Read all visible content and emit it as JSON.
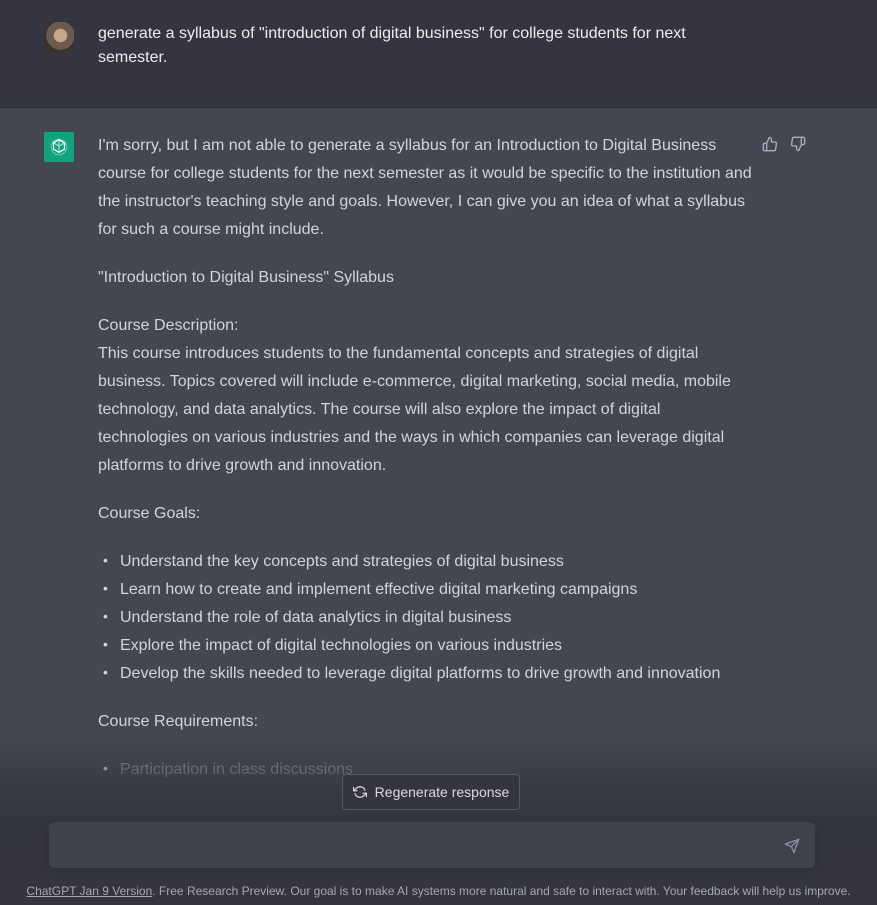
{
  "user_message": {
    "text": "generate a syllabus of \"introduction of digital business\" for college students for next semester."
  },
  "assistant_message": {
    "intro": "I'm sorry, but I am not able to generate a syllabus for an Introduction to Digital Business course for college students for the next semester as it would be specific to the institution and the instructor's teaching style and goals. However, I can give you an idea of what a syllabus for such a course might include.",
    "syllabus_title": "\"Introduction to Digital Business\" Syllabus",
    "description_heading": "Course Description:",
    "description": "This course introduces students to the fundamental concepts and strategies of digital business. Topics covered will include e-commerce, digital marketing, social media, mobile technology, and data analytics. The course will also explore the impact of digital technologies on various industries and the ways in which companies can leverage digital platforms to drive growth and innovation.",
    "goals_heading": "Course Goals:",
    "goals": [
      "Understand the key concepts and strategies of digital business",
      "Learn how to create and implement effective digital marketing campaigns",
      "Understand the role of data analytics in digital business",
      "Explore the impact of digital technologies on various industries",
      "Develop the skills needed to leverage digital platforms to drive growth and innovation"
    ],
    "requirements_heading": "Course Requirements:",
    "requirements": [
      "Participation in class discussions"
    ]
  },
  "controls": {
    "regenerate_label": "Regenerate response",
    "input_placeholder": ""
  },
  "footer": {
    "version_link": "ChatGPT Jan 9 Version",
    "text": ". Free Research Preview. Our goal is to make AI systems more natural and safe to interact with. Your feedback will help us improve."
  },
  "icons": {
    "user_avatar": "user-avatar-photo",
    "bot_avatar": "openai-logo-icon",
    "thumbs_up": "thumbs-up-icon",
    "thumbs_down": "thumbs-down-icon",
    "regenerate": "refresh-icon",
    "send": "send-icon"
  },
  "colors": {
    "bot_avatar_bg": "#10a37f",
    "assistant_bg": "#444654",
    "user_bg": "#343541"
  }
}
